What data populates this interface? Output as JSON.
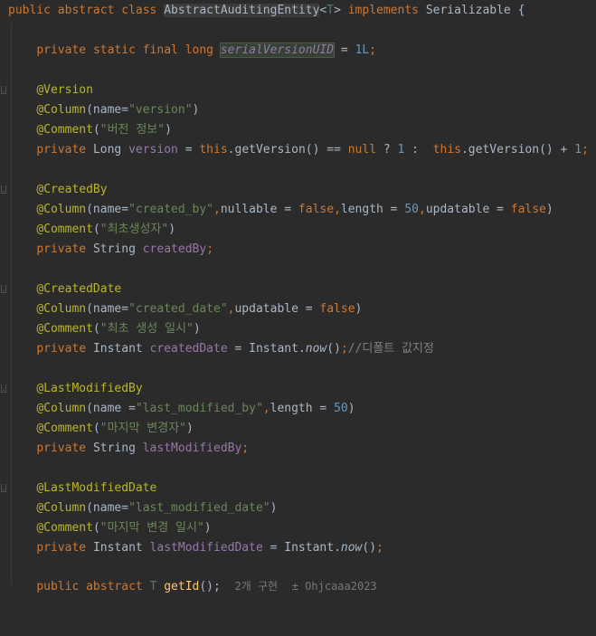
{
  "code": {
    "l1": {
      "public": "public",
      "abstract": "abstract",
      "class": "class",
      "name": "AbstractAuditingEntity",
      "lt": "<",
      "tparam": "T",
      "gt": ">",
      "implements": "implements",
      "iface": "Serializable",
      "brace": " {"
    },
    "l3": {
      "private": "private",
      "static": "static",
      "final": "final",
      "long": "long",
      "field": "serialVersionUID",
      "eq": " = ",
      "val": "1L",
      "semi": ";"
    },
    "l5": {
      "ann": "@Version"
    },
    "l6": {
      "ann": "@Column",
      "open": "(name=",
      "str": "\"version\"",
      "close": ")"
    },
    "l7": {
      "ann": "@Comment",
      "open": "(",
      "str": "\"버전 정보\"",
      "close": ")"
    },
    "l8": {
      "private": "private",
      "type": "Long",
      "field": "version",
      "eq": " = ",
      "this1": "this",
      "call1": ".getVersion() == ",
      "null": "null",
      "q": " ? ",
      "one1": "1",
      "colon": " :  ",
      "this2": "this",
      "call2": ".getVersion() + ",
      "one2": "1",
      "semi": ";"
    },
    "l10": {
      "ann": "@CreatedBy"
    },
    "l11": {
      "ann": "@Column",
      "open": "(name=",
      "str": "\"created_by\"",
      "comma1": ",",
      "nullable": "nullable = ",
      "false1": "false",
      "comma2": ",",
      "length": "length = ",
      "fifty": "50",
      "comma3": ",",
      "updatable": "updatable = ",
      "false2": "false",
      "close": ")"
    },
    "l12": {
      "ann": "@Comment",
      "open": "(",
      "str": "\"최초생성자\"",
      "close": ")"
    },
    "l13": {
      "private": "private",
      "type": "String",
      "field": "createdBy",
      "semi": ";"
    },
    "l15": {
      "ann": "@CreatedDate"
    },
    "l16": {
      "ann": "@Column",
      "open": "(name=",
      "str": "\"created_date\"",
      "comma1": ",",
      "updatable": "updatable = ",
      "false": "false",
      "close": ")"
    },
    "l17": {
      "ann": "@Comment",
      "open": "(",
      "str": "\"최초 생성 일시\"",
      "close": ")"
    },
    "l18": {
      "private": "private",
      "type": "Instant",
      "field": "createdDate",
      "eq": " = ",
      "cls": "Instant.",
      "method": "now",
      "paren": "()",
      "semi": ";",
      "comment": "//디폴트 값지정"
    },
    "l20": {
      "ann": "@LastModifiedBy"
    },
    "l21": {
      "ann": "@Column",
      "open": "(name =",
      "str": "\"last_modified_by\"",
      "comma1": ",",
      "length": "length = ",
      "fifty": "50",
      "close": ")"
    },
    "l22": {
      "ann": "@Comment",
      "open": "(",
      "str": "\"마지막 변경자\"",
      "close": ")"
    },
    "l23": {
      "private": "private",
      "type": "String",
      "field": "lastModifiedBy",
      "semi": ";"
    },
    "l25": {
      "ann": "@LastModifiedDate"
    },
    "l26": {
      "ann": "@Column",
      "open": "(name=",
      "str": "\"last_modified_date\"",
      "close": ")"
    },
    "l27": {
      "ann": "@Comment",
      "open": "(",
      "str": "\"마지막 변경 일시\"",
      "close": ")"
    },
    "l28": {
      "private": "private",
      "type": "Instant",
      "field": "lastModifiedDate",
      "eq": " = ",
      "cls": "Instant.",
      "method": "now",
      "paren": "()",
      "semi": ";"
    },
    "l30": {
      "public": "public",
      "abstract": "abstract",
      "tparam": "T",
      "method": "getId",
      "paren": "();",
      "hint1": "2개 구현",
      "hint2": "± Ohjcaaa2023"
    }
  }
}
